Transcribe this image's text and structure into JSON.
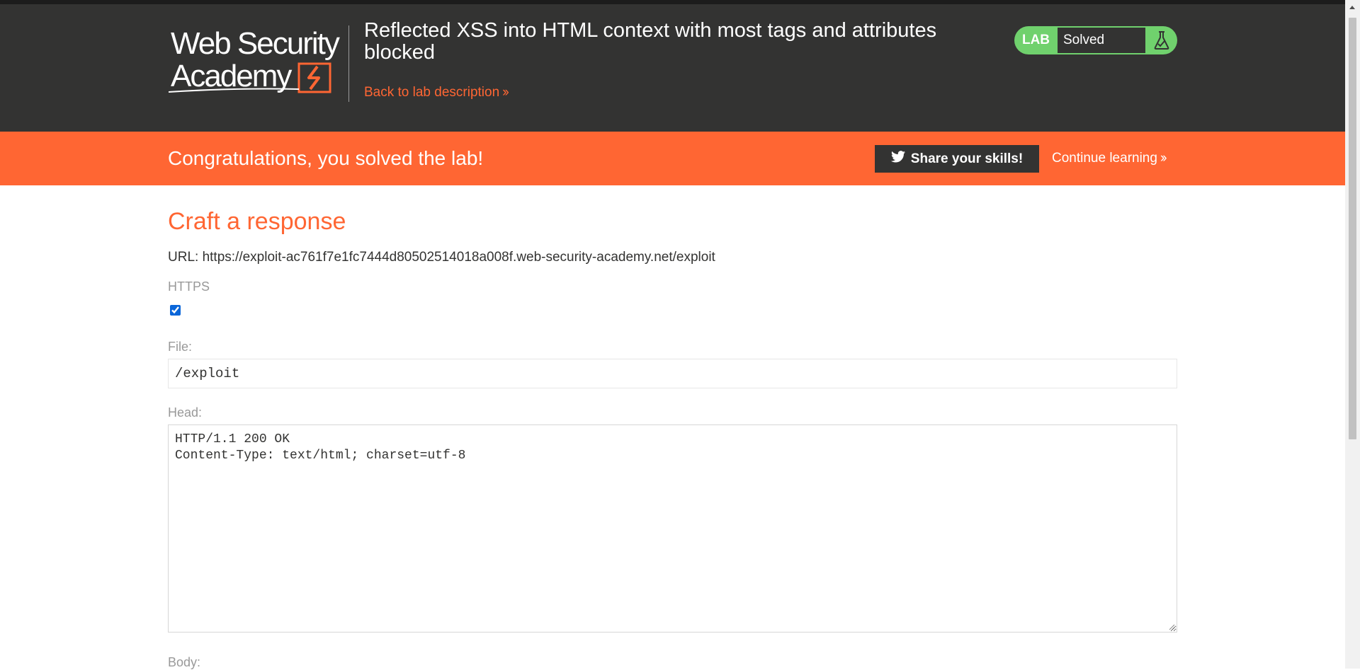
{
  "header": {
    "logo_line1": "Web Security",
    "logo_line2": "Academy",
    "lab_title": "Reflected XSS into HTML context with most tags and attributes blocked",
    "back_link": "Back to lab description",
    "status_label": "LAB",
    "status_text": "Solved",
    "status_color": "#70d16d"
  },
  "banner": {
    "message": "Congratulations, you solved the lab!",
    "share_button": "Share your skills!",
    "continue_link": "Continue learning"
  },
  "form": {
    "title": "Craft a response",
    "url_label": "URL:",
    "url_value": "https://exploit-ac761f7e1fc7444d80502514018a008f.web-security-academy.net/exploit",
    "https_label": "HTTPS",
    "https_checked": true,
    "file_label": "File:",
    "file_value": "/exploit",
    "head_label": "Head:",
    "head_value": "HTTP/1.1 200 OK\nContent-Type: text/html; charset=utf-8",
    "body_label": "Body:"
  },
  "colors": {
    "accent": "#ff6633",
    "dark": "#333332",
    "success": "#70d16d"
  }
}
